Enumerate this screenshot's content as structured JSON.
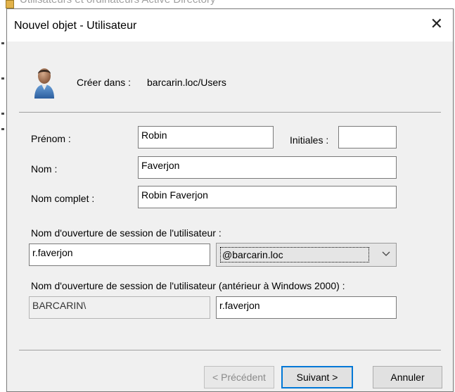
{
  "background_window": {
    "title": "Utilisateurs et ordinateurs Active Directory"
  },
  "dialog": {
    "title": "Nouvel objet - Utilisateur",
    "create_in_label": "Créer dans :",
    "create_in_path": "barcarin.loc/Users"
  },
  "form": {
    "first_name_label": "Prénom :",
    "first_name_value": "Robin",
    "initials_label": "Initiales :",
    "initials_value": "",
    "last_name_label": "Nom :",
    "last_name_value": "Faverjon",
    "full_name_label": "Nom complet :",
    "full_name_value": "Robin Faverjon",
    "logon_label": "Nom d'ouverture de session de l'utilisateur :",
    "logon_value": "r.faverjon",
    "domain_value": "@barcarin.loc",
    "legacy_label": "Nom d'ouverture de session de l'utilisateur (antérieur à Windows 2000) :",
    "legacy_prefix": "BARCARIN\\",
    "legacy_value": "r.faverjon"
  },
  "buttons": {
    "previous": "< Précédent",
    "next": "Suivant >",
    "cancel": "Annuler"
  },
  "icons": {
    "close": "close-icon",
    "user": "user-icon",
    "dropdown": "chevron-down-icon"
  },
  "colors": {
    "focus": "#0078d7"
  }
}
